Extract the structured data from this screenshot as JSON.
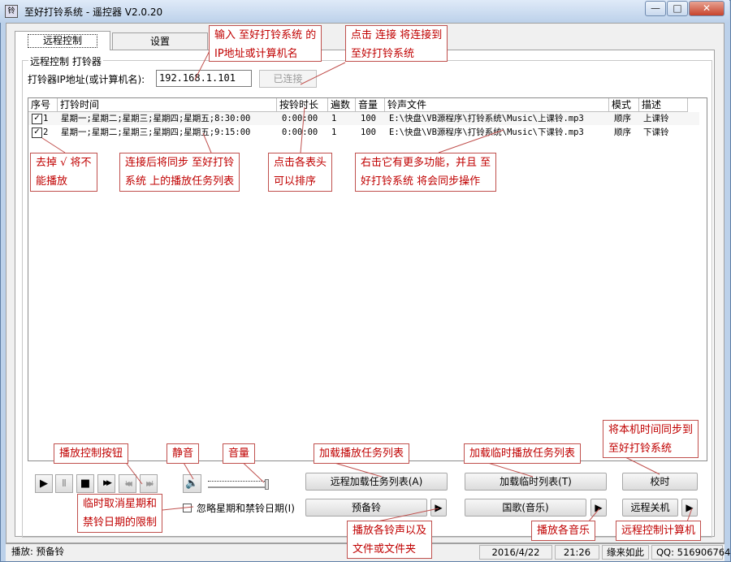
{
  "window": {
    "title": "至好打铃系统 - 遥控器 V2.0.20",
    "icon_label": "铃",
    "min": "—",
    "max": "□",
    "close": "✕"
  },
  "tabs": [
    {
      "label": "远程控制"
    },
    {
      "label": "设置"
    }
  ],
  "group": {
    "title": "远程控制 打铃器",
    "ip_label": "打铃器IP地址(或计算机名):",
    "ip_value": "192.168.1.101",
    "connect_label": "已连接"
  },
  "table": {
    "headers": [
      "序号",
      "打铃时间",
      "按铃时长",
      "遍数",
      "音量",
      "铃声文件",
      "模式",
      "描述"
    ],
    "rows": [
      {
        "checked": true,
        "no": "1",
        "time": "星期一;星期二;星期三;星期四;星期五;8:30:00",
        "duration": "0:00:00",
        "times": "1",
        "volume": "100",
        "file": "E:\\快盘\\VB源程序\\打铃系统\\Music\\上课铃.mp3",
        "mode": "顺序",
        "desc": "上课铃"
      },
      {
        "checked": true,
        "no": "2",
        "time": "星期一;星期二;星期三;星期四;星期五;9:15:00",
        "duration": "0:00:00",
        "times": "1",
        "volume": "100",
        "file": "E:\\快盘\\VB源程序\\打铃系统\\Music\\下课铃.mp3",
        "mode": "顺序",
        "desc": "下课铃"
      }
    ]
  },
  "notes": {
    "ip": [
      "输入 至好打铃系统 的",
      "IP地址或计算机名"
    ],
    "connect": [
      "点击 连接 将连接到",
      "至好打铃系统"
    ],
    "uncheck": [
      "去掉 √ 将不",
      "能播放"
    ],
    "sync": [
      "连接后将同步 至好打铃",
      "系统 上的播放任务列表"
    ],
    "sort": [
      "点击各表头",
      "可以排序"
    ],
    "context": [
      "右击它有更多功能，并且 至",
      "好打铃系统 将会同步操作"
    ],
    "playback": "播放控制按钮",
    "mute": "静音",
    "volume": "音量",
    "load_tasks": "加载播放任务列表",
    "load_temp": "加载临时播放任务列表",
    "timesync": [
      "将本机时间同步到",
      "至好打铃系统"
    ],
    "temp_cancel": [
      "临时取消星期和",
      "禁铃日期的限制"
    ],
    "play_files": [
      "播放各铃声以及",
      "文件或文件夹"
    ],
    "play_music": "播放各音乐",
    "remote_pc": "远程控制计算机"
  },
  "controls": {
    "transport_icons": [
      "play-icon",
      "pause-icon",
      "stop-icon",
      "next-icon",
      "skip-back-icon",
      "skip-forward-icon"
    ],
    "transport_glyphs": [
      "▶",
      "Ⅱ",
      "■",
      "▶▶",
      "I◀◀",
      "▶▶I"
    ],
    "speaker_glyph": "🔈",
    "remote_load_btn": "远程加载任务列表(A)",
    "load_temp_btn": "加载临时列表(T)",
    "timesync_btn": "校时",
    "ignore_checkbox": "忽略星期和禁铃日期(I)",
    "bell_btn": "预备铃",
    "anthem_btn": "国歌(音乐)",
    "shutdown_btn": "远程关机",
    "arrow": "▶"
  },
  "status": {
    "playing": "播放: 预备铃",
    "date": "2016/4/22",
    "time": "21:26",
    "user": "缘来如此",
    "qq": "QQ: 516906764"
  },
  "colors": {
    "annotation": "#c00000",
    "annotation_border": "#c0504d",
    "titlebar": "#bcd1ea"
  }
}
